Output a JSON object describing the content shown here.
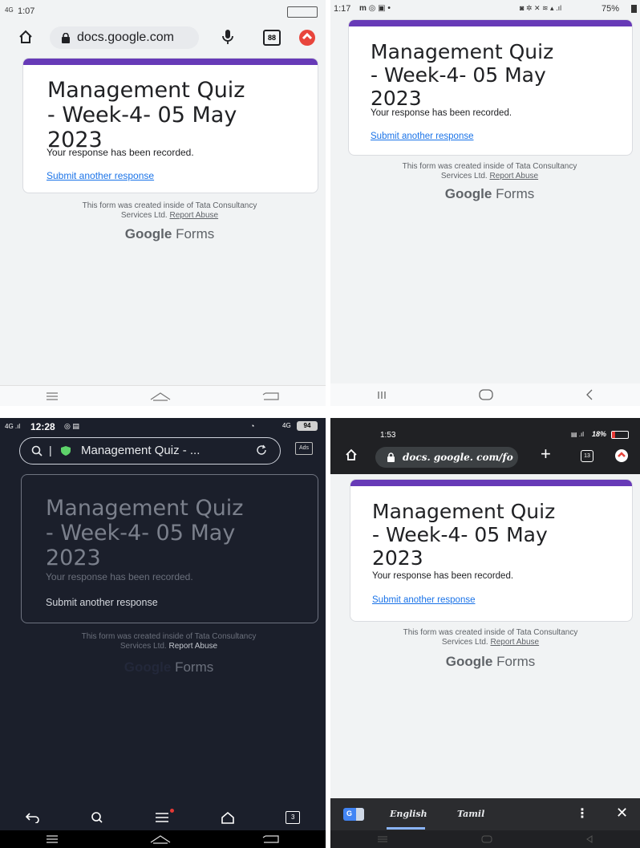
{
  "form": {
    "title_line1": "Management Quiz",
    "title_line2": "- Week-4- 05 May",
    "title_line3": "2023",
    "response_text": "Your response has been recorded.",
    "submit_another": "Submit another response",
    "footer_line1": "This form was created inside of Tata Consultancy",
    "footer_line2": "Services Ltd.",
    "report_abuse": "Report Abuse",
    "google_brand": "Google",
    "forms_brand": "Forms"
  },
  "panel1": {
    "status_time": "1:07",
    "status_network": "4G",
    "url": "docs.google.com",
    "tab_count": "88"
  },
  "panel2": {
    "status_time": "1:17",
    "status_battery": "75%"
  },
  "panel3": {
    "status_time": "12:28",
    "status_battery": "94",
    "status_network": "4G",
    "url_title": "Management Quiz - ...",
    "ads_label": "Ads",
    "tab_count": "3"
  },
  "panel4": {
    "status_time": "1:53",
    "status_battery": "18%",
    "url": "docs. google. com/fo",
    "tab_count": "13",
    "translate_lang1": "English",
    "translate_lang2": "Tamil"
  },
  "colors": {
    "accent_purple": "#673ab7",
    "link_blue": "#1a73e8",
    "dark_bg": "#1b1f2b"
  }
}
